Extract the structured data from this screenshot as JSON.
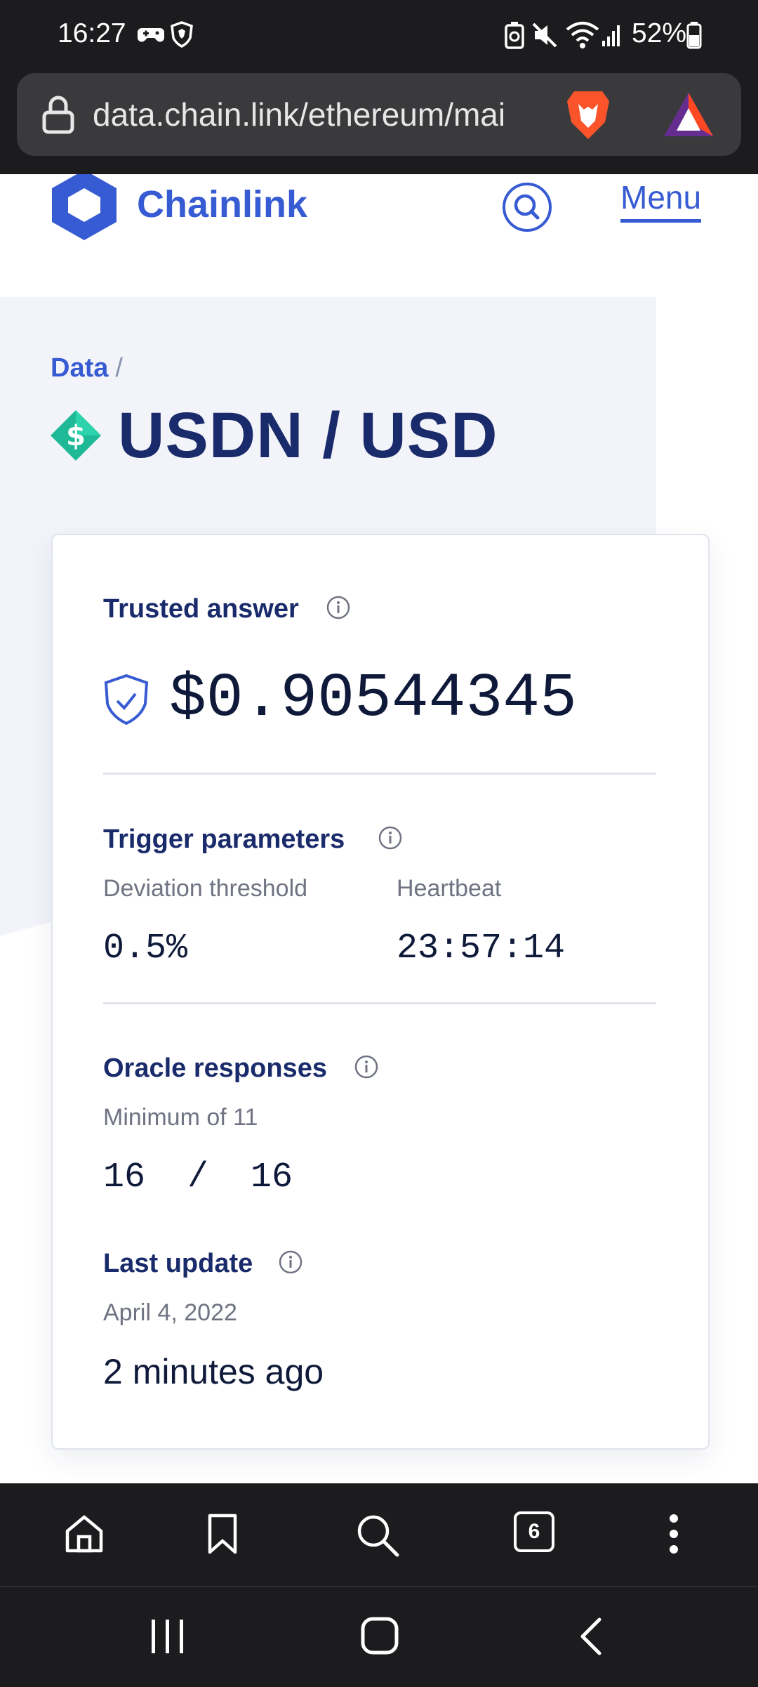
{
  "status_bar": {
    "time": "16:27",
    "battery_percent": "52%",
    "icons": [
      "game-controller-icon",
      "brave-shield-icon",
      "battery-saver-icon",
      "mute-icon",
      "wifi-icon",
      "signal-icon",
      "battery-icon"
    ]
  },
  "browser": {
    "url": "data.chain.link/ethereum/mai",
    "tab_count": "6"
  },
  "header": {
    "brand": "Chainlink",
    "menu_label": "Menu"
  },
  "breadcrumb": {
    "root": "Data",
    "separator": "/"
  },
  "title": "USDN / USD",
  "card": {
    "trusted_answer_label": "Trusted answer",
    "trusted_answer_value": "$0.90544345",
    "trigger_label": "Trigger parameters",
    "deviation_label": "Deviation threshold",
    "deviation_value": "0.5%",
    "heartbeat_label": "Heartbeat",
    "heartbeat_value": "23:57:14",
    "oracle_label": "Oracle responses",
    "oracle_min": "Minimum of 11",
    "oracle_value": "16  /  16",
    "last_update_label": "Last update",
    "last_update_date": "April 4, 2022",
    "last_update_ago": "2 minutes ago"
  },
  "colors": {
    "brand": "#375bd2",
    "heading": "#1a2b6b",
    "chrome": "#1c1c1e",
    "coin": "#20b997"
  }
}
